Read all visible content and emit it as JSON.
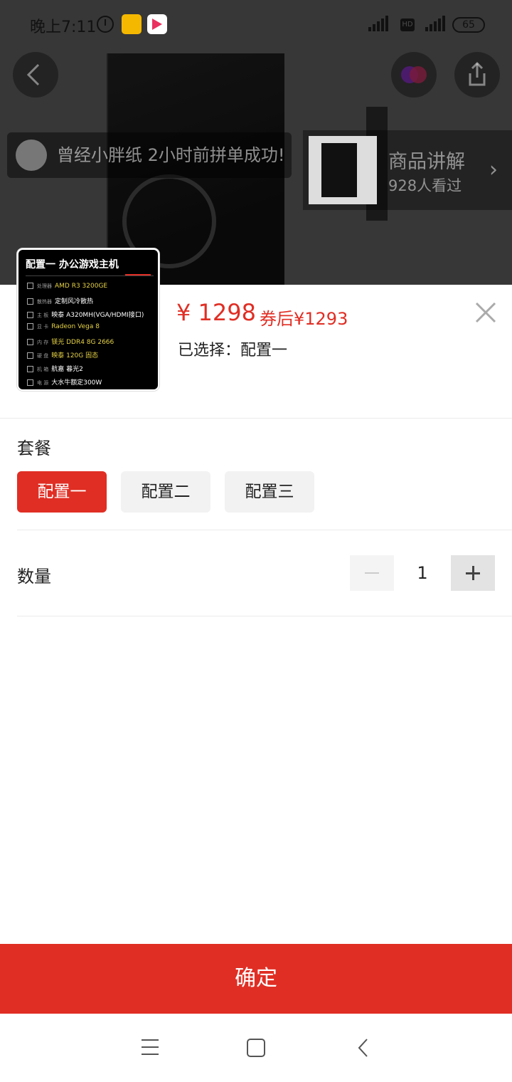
{
  "status_bar": {
    "time": "晚上7:11",
    "battery": "65",
    "network_1": "4G",
    "network_2": "4G",
    "hd": "HD"
  },
  "background": {
    "notice": "曾经小胖纸 2小时前拼单成功!",
    "explain_title": "商品讲解",
    "explain_viewers": "928人看过"
  },
  "product": {
    "card_title": "配置一 办公游戏主机",
    "specs": [
      {
        "key": "处理器",
        "value": "AMD R3 3200GE",
        "highlight": true
      },
      {
        "key": "散热器",
        "value": "定制风冷散热",
        "highlight": false
      },
      {
        "key": "主 板",
        "value": "映泰 A320MH(VGA/HDMI接口)",
        "highlight": false
      },
      {
        "key": "显 卡",
        "value": "Radeon Vega 8",
        "highlight": true
      },
      {
        "key": "内 存",
        "value": "镁光 DDR4 8G 2666",
        "highlight": true
      },
      {
        "key": "硬 盘",
        "value": "映泰 120G 固态",
        "highlight": true
      },
      {
        "key": "机 箱",
        "value": "航嘉 暮光2",
        "highlight": false
      },
      {
        "key": "电 源",
        "value": "大水牛额定300W",
        "highlight": false
      }
    ],
    "price": "¥ 1298",
    "coupon_price": "券后¥1293",
    "selected_text": "已选择：配置一"
  },
  "package": {
    "label": "套餐",
    "options": [
      "配置一",
      "配置二",
      "配置三"
    ],
    "selected_index": 0
  },
  "quantity": {
    "label": "数量",
    "value": "1"
  },
  "confirm_label": "确定",
  "colors": {
    "accent": "#e02e24",
    "option_bg": "#f2f2f2"
  }
}
